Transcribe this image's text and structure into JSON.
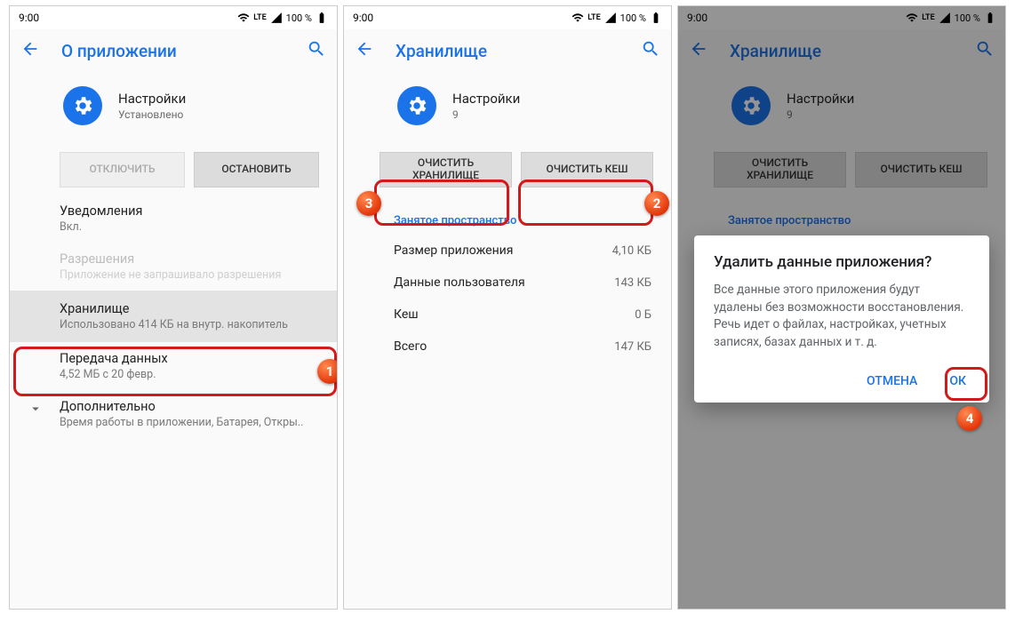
{
  "status": {
    "time": "9:00",
    "battery": "100 %",
    "net": "LTE"
  },
  "screen1": {
    "title": "О приложении",
    "app": {
      "name": "Настройки",
      "sub": "Установлено"
    },
    "btn_disable": "ОТКЛЮЧИТЬ",
    "btn_stop": "ОСТАНОВИТЬ",
    "notif": {
      "title": "Уведомления",
      "sub": "Вкл."
    },
    "perm": {
      "title": "Разрешения",
      "sub": "Приложение не запрашивало разрешения"
    },
    "storage": {
      "title": "Хранилище",
      "sub": "Использовано 414 КБ на внутр. накопитель"
    },
    "data": {
      "title": "Передача данных",
      "sub": "4,52 МБ с 20 февр."
    },
    "more": {
      "title": "Дополнительно",
      "sub": "Время работы в приложении, Батарея, Откры.."
    }
  },
  "screen2": {
    "title": "Хранилище",
    "app": {
      "name": "Настройки",
      "sub": "9"
    },
    "btn_clear_storage": "ОЧИСТИТЬ ХРАНИЛИЩЕ",
    "btn_clear_cache": "ОЧИСТИТЬ КЕШ",
    "section": "Занятое пространство",
    "rows": {
      "app_size": {
        "label": "Размер приложения",
        "value": "4,10 КБ"
      },
      "user_data": {
        "label": "Данные пользователя",
        "value": "143 КБ"
      },
      "cache": {
        "label": "Кеш",
        "value": "0 Б"
      },
      "total": {
        "label": "Всего",
        "value": "147 КБ"
      }
    }
  },
  "screen3": {
    "title": "Хранилище",
    "app": {
      "name": "Настройки",
      "sub": "9"
    },
    "btn_clear_storage": "ОЧИСТИТЬ ХРАНИЛИЩЕ",
    "btn_clear_cache": "ОЧИСТИТЬ КЕШ",
    "section": "Занятое пространство",
    "dialog": {
      "title": "Удалить данные приложения?",
      "body": "Все данные этого приложения будут удалены без возможности восстановления. Речь идет о файлах, настройках, учетных записях, базах данных и т. д.",
      "cancel": "ОТМЕНА",
      "ok": "ОК"
    }
  },
  "badges": {
    "b1": "1",
    "b2": "2",
    "b3": "3",
    "b4": "4"
  }
}
